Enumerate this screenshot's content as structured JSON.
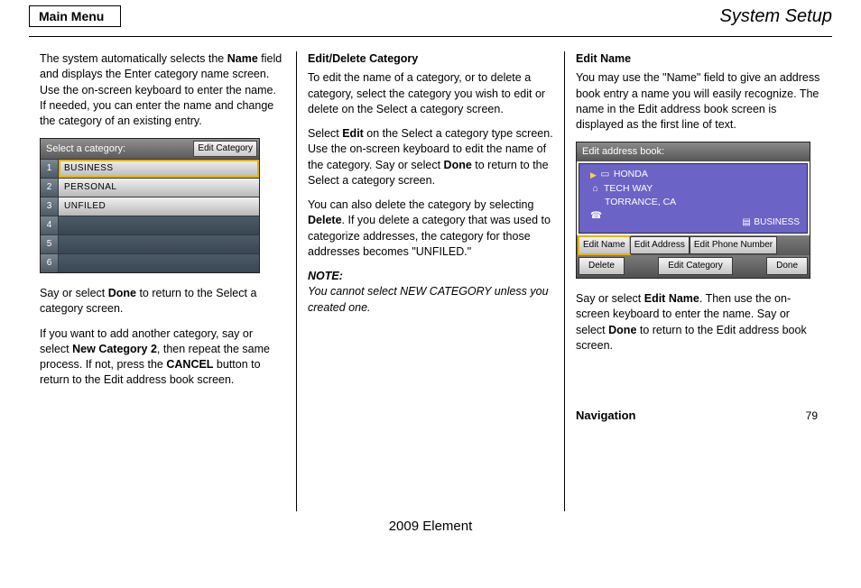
{
  "header": {
    "tab": "Main Menu",
    "section": "System Setup",
    "page": "79"
  },
  "col1": {
    "p1": "The system automatically selects the <b>Name</b> field and displays the Enter category name screen. Use the on-screen keyboard to enter the name. If needed, you can enter the name and change the category of an existing entry.",
    "p2a_pre": "Say or select ",
    "p2a_bold": "Done",
    "p2a_post": " to return to the Select a category screen.",
    "p3": "If you want to add another category, say or select <b>New Category 2</b>, then repeat the same process. If not, press the <b>CANCEL</b> button to return to the Edit address book screen."
  },
  "col2": {
    "h1": "Edit/Delete Category",
    "p1": "To edit the name of a category, or to delete a category, select the category you wish to edit or delete on the Select a category screen.",
    "p2": "Select <b>Edit</b> on the Select a category type screen. Use the on-screen keyboard to edit the name of the category. Say or select <b>Done</b> to return to the Select a category screen.",
    "p3": "You can also delete the category by selecting <b>Delete</b>. If you delete a category that was used to categorize addresses, the category for those addresses becomes \"UNFILED.\"",
    "note_label": "NOTE:",
    "note_body": "You cannot select NEW CATEGORY unless you created one."
  },
  "col3": {
    "h1": "Edit Name",
    "p1": "You may use the \"Name\" field to give an address book entry a name you will easily recognize. The name in the Edit address book screen is displayed as the first line of text.",
    "p2": "Say or select <b>Edit Name</b>. Then use the on-screen keyboard to enter the name. Say or select <b>Done</b> to return to the Edit address book screen."
  },
  "shot1": {
    "title": "Select a category:",
    "button": "Edit Category",
    "rows": [
      {
        "n": "1",
        "label": "BUSINESS",
        "filled": true,
        "selected": true
      },
      {
        "n": "2",
        "label": "PERSONAL",
        "filled": true,
        "selected": false
      },
      {
        "n": "3",
        "label": "UNFILED",
        "filled": true,
        "selected": false
      },
      {
        "n": "4",
        "label": "",
        "filled": false,
        "selected": false
      },
      {
        "n": "5",
        "label": "",
        "filled": false,
        "selected": false
      },
      {
        "n": "6",
        "label": "",
        "filled": false,
        "selected": false
      }
    ]
  },
  "shot2": {
    "title": "Edit address book:",
    "name": "HONDA",
    "addr1": "TECH WAY",
    "addr2": "TORRANCE, CA",
    "cat_label": "BUSINESS",
    "btn_edit_name": "Edit Name",
    "btn_edit_address": "Edit Address",
    "btn_edit_phone": "Edit Phone Number",
    "btn_delete": "Delete",
    "btn_edit_category": "Edit Category",
    "btn_done": "Done"
  },
  "footer": {
    "model": "2009  Element",
    "nav_label": "Navigation"
  }
}
